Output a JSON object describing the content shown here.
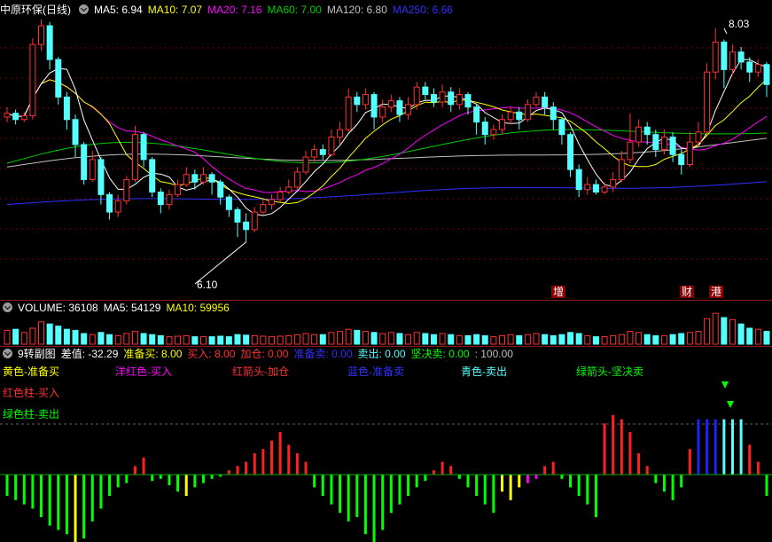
{
  "colors": {
    "bg": "#000000",
    "up": "#ff3232",
    "down": "#54ffff",
    "ma5": "#ffffff",
    "ma10": "#ffff00",
    "ma20": "#ff00ff",
    "ma60": "#00cc00",
    "ma120": "#c0c0c0",
    "ma250": "#3030ff",
    "grid": "#7a0000"
  },
  "price_panel": {
    "stock": "中原环保(日线)",
    "ma": [
      {
        "label": "MA5: 6.94",
        "color": "#ffffff"
      },
      {
        "label": "MA10: 7.07",
        "color": "#ffff00"
      },
      {
        "label": "MA20: 7.16",
        "color": "#ff00ff"
      },
      {
        "label": "MA60: 7.00",
        "color": "#00cc00"
      },
      {
        "label": "MA120: 6.80",
        "color": "#c0c0c0"
      },
      {
        "label": "MA250: 6.66",
        "color": "#3030ff"
      }
    ],
    "high_label": "8.03",
    "low_label": "6.10",
    "markers": [
      "增",
      "财",
      "港"
    ]
  },
  "volume_panel": {
    "items": [
      {
        "label": "VOLUME: 36108",
        "color": "#ffffff"
      },
      {
        "label": "MA5: 54129",
        "color": "#ffffff"
      },
      {
        "label": "MA10: 59956",
        "color": "#ffff00"
      }
    ]
  },
  "indicator_panel": {
    "title": "9转副图",
    "items": [
      {
        "label": "差值: -32.29",
        "color": "#ffffff"
      },
      {
        "label": "准备买: 8.00",
        "color": "#ffff00"
      },
      {
        "label": "买入: 8.00",
        "color": "#ff3232"
      },
      {
        "label": "加仓: 0.00",
        "color": "#ff3232"
      },
      {
        "label": "准备卖: 0.00",
        "color": "#3030ff"
      },
      {
        "label": "卖出: 0.00",
        "color": "#54ffff"
      },
      {
        "label": "坚决卖: 0.00",
        "color": "#00ff00"
      },
      {
        "label": ": 100.00",
        "color": "#c0c0c0"
      }
    ],
    "legend": [
      {
        "label": "黄色-准备买",
        "color": "#ffff00"
      },
      {
        "label": "洋红色-买入",
        "color": "#ff00ff"
      },
      {
        "label": "红箭头-加仓",
        "color": "#ff3232"
      },
      {
        "label": "蓝色-准备卖",
        "color": "#3030ff"
      },
      {
        "label": "青色-卖出",
        "color": "#54ffff"
      },
      {
        "label": "绿箭头-坚决卖",
        "color": "#00ff00"
      },
      {
        "label": "红色柱-买入",
        "color": "#ff3232"
      },
      {
        "label": "绿色柱-卖出",
        "color": "#00ff00"
      }
    ]
  },
  "chart_data": {
    "type": "candlestick",
    "price_range": [
      6.0,
      8.1
    ],
    "candles": [
      [
        7.32,
        7.35,
        7.4,
        7.28
      ],
      [
        7.35,
        7.3,
        7.38,
        7.26
      ],
      [
        7.3,
        7.33,
        7.36,
        7.28
      ],
      [
        7.33,
        7.9,
        7.95,
        7.3
      ],
      [
        7.9,
        8.05,
        8.1,
        7.85
      ],
      [
        8.05,
        7.78,
        8.08,
        7.7
      ],
      [
        7.78,
        7.48,
        7.8,
        7.42
      ],
      [
        7.48,
        7.3,
        7.52,
        7.22
      ],
      [
        7.3,
        7.1,
        7.34,
        7.0
      ],
      [
        7.1,
        6.82,
        7.12,
        6.78
      ],
      [
        6.82,
        6.98,
        7.05,
        6.8
      ],
      [
        6.98,
        6.7,
        7.0,
        6.62
      ],
      [
        6.7,
        6.56,
        6.72,
        6.5
      ],
      [
        6.56,
        6.65,
        6.7,
        6.52
      ],
      [
        6.65,
        6.82,
        6.85,
        6.62
      ],
      [
        6.82,
        7.18,
        7.25,
        6.8
      ],
      [
        7.18,
        6.98,
        7.2,
        6.92
      ],
      [
        6.98,
        6.72,
        7.0,
        6.68
      ],
      [
        6.72,
        6.62,
        6.75,
        6.55
      ],
      [
        6.62,
        6.7,
        6.74,
        6.58
      ],
      [
        6.7,
        6.78,
        6.82,
        6.68
      ],
      [
        6.78,
        6.86,
        6.92,
        6.76
      ],
      [
        6.86,
        6.8,
        6.9,
        6.74
      ],
      [
        6.8,
        6.86,
        6.92,
        6.78
      ],
      [
        6.86,
        6.8,
        6.88,
        6.7
      ],
      [
        6.8,
        6.68,
        6.82,
        6.62
      ],
      [
        6.68,
        6.58,
        6.7,
        6.52
      ],
      [
        6.58,
        6.48,
        6.6,
        6.36
      ],
      [
        6.48,
        6.42,
        6.55,
        6.32
      ],
      [
        6.42,
        6.56,
        6.6,
        6.4
      ],
      [
        6.56,
        6.62,
        6.66,
        6.54
      ],
      [
        6.62,
        6.66,
        6.7,
        6.58
      ],
      [
        6.66,
        6.72,
        6.76,
        6.64
      ],
      [
        6.72,
        6.76,
        6.82,
        6.7
      ],
      [
        6.76,
        6.88,
        6.92,
        6.74
      ],
      [
        6.88,
        7.0,
        7.05,
        6.86
      ],
      [
        7.0,
        7.06,
        7.1,
        6.96
      ],
      [
        7.06,
        7.02,
        7.1,
        6.98
      ],
      [
        7.02,
        7.16,
        7.22,
        7.0
      ],
      [
        7.16,
        7.22,
        7.28,
        7.1
      ],
      [
        7.22,
        7.48,
        7.55,
        7.2
      ],
      [
        7.48,
        7.42,
        7.52,
        7.36
      ],
      [
        7.42,
        7.5,
        7.55,
        7.38
      ],
      [
        7.5,
        7.32,
        7.52,
        7.22
      ],
      [
        7.32,
        7.4,
        7.46,
        7.28
      ],
      [
        7.4,
        7.45,
        7.5,
        7.36
      ],
      [
        7.45,
        7.34,
        7.48,
        7.28
      ],
      [
        7.34,
        7.42,
        7.48,
        7.3
      ],
      [
        7.42,
        7.56,
        7.6,
        7.38
      ],
      [
        7.56,
        7.5,
        7.6,
        7.46
      ],
      [
        7.5,
        7.44,
        7.55,
        7.4
      ],
      [
        7.44,
        7.52,
        7.58,
        7.4
      ],
      [
        7.52,
        7.42,
        7.56,
        7.36
      ],
      [
        7.42,
        7.5,
        7.55,
        7.38
      ],
      [
        7.5,
        7.4,
        7.52,
        7.34
      ],
      [
        7.4,
        7.28,
        7.42,
        7.18
      ],
      [
        7.28,
        7.18,
        7.32,
        7.1
      ],
      [
        7.18,
        7.22,
        7.26,
        7.14
      ],
      [
        7.22,
        7.3,
        7.34,
        7.18
      ],
      [
        7.3,
        7.36,
        7.4,
        7.26
      ],
      [
        7.36,
        7.3,
        7.4,
        7.22
      ],
      [
        7.3,
        7.42,
        7.46,
        7.28
      ],
      [
        7.42,
        7.48,
        7.52,
        7.4
      ],
      [
        7.48,
        7.4,
        7.52,
        7.34
      ],
      [
        7.4,
        7.3,
        7.44,
        7.22
      ],
      [
        7.3,
        7.18,
        7.32,
        7.1
      ],
      [
        7.18,
        6.9,
        7.2,
        6.84
      ],
      [
        6.9,
        6.74,
        6.94,
        6.68
      ],
      [
        6.74,
        6.78,
        6.84,
        6.7
      ],
      [
        6.78,
        6.72,
        6.82,
        6.7
      ],
      [
        6.72,
        6.76,
        6.8,
        6.7
      ],
      [
        6.76,
        6.82,
        6.88,
        6.72
      ],
      [
        6.82,
        6.98,
        7.05,
        6.8
      ],
      [
        6.98,
        7.12,
        7.35,
        6.95
      ],
      [
        7.12,
        7.24,
        7.3,
        7.08
      ],
      [
        7.24,
        7.18,
        7.28,
        7.1
      ],
      [
        7.18,
        7.06,
        7.22,
        7.0
      ],
      [
        7.06,
        7.16,
        7.22,
        7.02
      ],
      [
        7.16,
        7.02,
        7.2,
        6.96
      ],
      [
        7.02,
        6.94,
        7.06,
        6.86
      ],
      [
        6.94,
        7.12,
        7.2,
        6.92
      ],
      [
        7.12,
        7.2,
        7.28,
        7.08
      ],
      [
        7.2,
        7.68,
        7.75,
        7.18
      ],
      [
        7.68,
        7.92,
        8.03,
        7.62
      ],
      [
        7.92,
        7.7,
        7.94,
        7.55
      ],
      [
        7.7,
        7.84,
        7.9,
        7.66
      ],
      [
        7.84,
        7.76,
        7.88,
        7.7
      ],
      [
        7.76,
        7.68,
        7.8,
        7.6
      ],
      [
        7.68,
        7.74,
        7.78,
        7.64
      ],
      [
        7.74,
        7.58,
        7.76,
        7.48
      ]
    ],
    "indicator_range": [
      -40,
      60
    ],
    "indicator": [
      [
        -10,
        "g"
      ],
      [
        -12,
        "g"
      ],
      [
        -14,
        "g"
      ],
      [
        -16,
        "g"
      ],
      [
        -20,
        "g"
      ],
      [
        -24,
        "g"
      ],
      [
        -26,
        "g"
      ],
      [
        -28,
        "g"
      ],
      [
        -35,
        "y"
      ],
      [
        -30,
        "g"
      ],
      [
        -22,
        "g"
      ],
      [
        -16,
        "g"
      ],
      [
        -10,
        "g"
      ],
      [
        -6,
        "g"
      ],
      [
        -4,
        "g"
      ],
      [
        4,
        "r"
      ],
      [
        8,
        "r"
      ],
      [
        -3,
        "g"
      ],
      [
        -2,
        "g"
      ],
      [
        -5,
        "g"
      ],
      [
        -8,
        "g"
      ],
      [
        -10,
        "y"
      ],
      [
        -6,
        "g"
      ],
      [
        -4,
        "g"
      ],
      [
        -2,
        "g"
      ],
      [
        -1,
        "g"
      ],
      [
        2,
        "r"
      ],
      [
        4,
        "r"
      ],
      [
        6,
        "r"
      ],
      [
        10,
        "r"
      ],
      [
        12,
        "r"
      ],
      [
        16,
        "r"
      ],
      [
        20,
        "r"
      ],
      [
        14,
        "r"
      ],
      [
        10,
        "r"
      ],
      [
        6,
        "r"
      ],
      [
        -6,
        "g"
      ],
      [
        -10,
        "g"
      ],
      [
        -14,
        "g"
      ],
      [
        -18,
        "g"
      ],
      [
        -22,
        "g"
      ],
      [
        -20,
        "g"
      ],
      [
        -28,
        "g"
      ],
      [
        -32,
        "g"
      ],
      [
        -26,
        "g"
      ],
      [
        -18,
        "g"
      ],
      [
        -14,
        "g"
      ],
      [
        -10,
        "g"
      ],
      [
        -6,
        "g"
      ],
      [
        -3,
        "g"
      ],
      [
        2,
        "r"
      ],
      [
        6,
        "r"
      ],
      [
        4,
        "r"
      ],
      [
        -2,
        "g"
      ],
      [
        -6,
        "g"
      ],
      [
        -10,
        "g"
      ],
      [
        -14,
        "g"
      ],
      [
        -18,
        "g"
      ],
      [
        -8,
        "y"
      ],
      [
        -12,
        "y"
      ],
      [
        -6,
        "y"
      ],
      [
        -4,
        "m"
      ],
      [
        -2,
        "m"
      ],
      [
        4,
        "r"
      ],
      [
        6,
        "r"
      ],
      [
        -2,
        "g"
      ],
      [
        -6,
        "g"
      ],
      [
        -10,
        "g"
      ],
      [
        -14,
        "g"
      ],
      [
        -20,
        "g"
      ],
      [
        24,
        "r"
      ],
      [
        28,
        "r"
      ],
      [
        26,
        "r"
      ],
      [
        20,
        "r"
      ],
      [
        10,
        "r"
      ],
      [
        4,
        "r"
      ],
      [
        -4,
        "g"
      ],
      [
        -8,
        "g"
      ],
      [
        -12,
        "g"
      ],
      [
        -6,
        "g"
      ],
      [
        12,
        "r"
      ],
      [
        26,
        "b"
      ],
      [
        26,
        "b"
      ],
      [
        26,
        "b"
      ],
      [
        26,
        "c"
      ],
      [
        26,
        "c"
      ],
      [
        26,
        "c"
      ],
      [
        14,
        "r"
      ],
      [
        6,
        "r"
      ],
      [
        -10,
        "g"
      ]
    ],
    "volume": [
      [
        26,
        "u"
      ],
      [
        28,
        "d"
      ],
      [
        22,
        "u"
      ],
      [
        30,
        "u"
      ],
      [
        42,
        "u"
      ],
      [
        38,
        "d"
      ],
      [
        34,
        "d"
      ],
      [
        28,
        "d"
      ],
      [
        26,
        "d"
      ],
      [
        20,
        "d"
      ],
      [
        18,
        "u"
      ],
      [
        22,
        "d"
      ],
      [
        18,
        "d"
      ],
      [
        16,
        "u"
      ],
      [
        20,
        "u"
      ],
      [
        24,
        "u"
      ],
      [
        20,
        "d"
      ],
      [
        18,
        "d"
      ],
      [
        16,
        "d"
      ],
      [
        14,
        "u"
      ],
      [
        15,
        "u"
      ],
      [
        16,
        "u"
      ],
      [
        14,
        "d"
      ],
      [
        14,
        "u"
      ],
      [
        14,
        "d"
      ],
      [
        15,
        "d"
      ],
      [
        14,
        "d"
      ],
      [
        18,
        "d"
      ],
      [
        17,
        "d"
      ],
      [
        16,
        "u"
      ],
      [
        15,
        "u"
      ],
      [
        14,
        "u"
      ],
      [
        15,
        "u"
      ],
      [
        16,
        "u"
      ],
      [
        18,
        "u"
      ],
      [
        20,
        "u"
      ],
      [
        18,
        "u"
      ],
      [
        18,
        "d"
      ],
      [
        22,
        "u"
      ],
      [
        24,
        "u"
      ],
      [
        28,
        "u"
      ],
      [
        26,
        "d"
      ],
      [
        24,
        "u"
      ],
      [
        22,
        "d"
      ],
      [
        20,
        "u"
      ],
      [
        22,
        "u"
      ],
      [
        20,
        "d"
      ],
      [
        18,
        "u"
      ],
      [
        22,
        "u"
      ],
      [
        20,
        "d"
      ],
      [
        18,
        "d"
      ],
      [
        20,
        "u"
      ],
      [
        18,
        "d"
      ],
      [
        16,
        "u"
      ],
      [
        16,
        "d"
      ],
      [
        18,
        "d"
      ],
      [
        16,
        "d"
      ],
      [
        14,
        "u"
      ],
      [
        16,
        "u"
      ],
      [
        18,
        "u"
      ],
      [
        16,
        "d"
      ],
      [
        18,
        "u"
      ],
      [
        20,
        "u"
      ],
      [
        18,
        "d"
      ],
      [
        16,
        "d"
      ],
      [
        18,
        "d"
      ],
      [
        22,
        "d"
      ],
      [
        20,
        "d"
      ],
      [
        16,
        "u"
      ],
      [
        14,
        "d"
      ],
      [
        14,
        "u"
      ],
      [
        16,
        "u"
      ],
      [
        18,
        "u"
      ],
      [
        24,
        "u"
      ],
      [
        22,
        "u"
      ],
      [
        18,
        "d"
      ],
      [
        16,
        "d"
      ],
      [
        16,
        "u"
      ],
      [
        18,
        "d"
      ],
      [
        20,
        "d"
      ],
      [
        22,
        "u"
      ],
      [
        24,
        "u"
      ],
      [
        48,
        "u"
      ],
      [
        58,
        "u"
      ],
      [
        50,
        "d"
      ],
      [
        46,
        "u"
      ],
      [
        38,
        "d"
      ],
      [
        30,
        "d"
      ],
      [
        28,
        "u"
      ],
      [
        24,
        "d"
      ]
    ]
  }
}
